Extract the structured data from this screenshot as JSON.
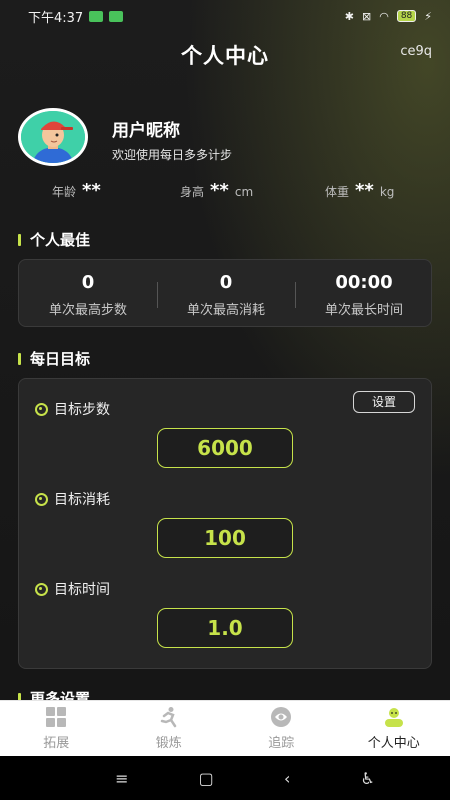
{
  "status_bar": {
    "time": "下午4:37",
    "battery": "88"
  },
  "header": {
    "title": "个人中心",
    "code": "ce9q"
  },
  "profile": {
    "nickname": "用户昵称",
    "welcome": "欢迎使用每日多多计步",
    "stats": [
      {
        "label": "年龄",
        "value": "**",
        "unit": ""
      },
      {
        "label": "身高",
        "value": "**",
        "unit": "cm"
      },
      {
        "label": "体重",
        "value": "**",
        "unit": "kg"
      }
    ]
  },
  "best": {
    "title": "个人最佳",
    "items": [
      {
        "value": "0",
        "label": "单次最高步数"
      },
      {
        "value": "0",
        "label": "单次最高消耗"
      },
      {
        "value": "00:00",
        "label": "单次最长时间"
      }
    ]
  },
  "daily": {
    "title": "每日目标",
    "set_button": "设置",
    "goals": [
      {
        "label": "目标步数",
        "value": "6000"
      },
      {
        "label": "目标消耗",
        "value": "100"
      },
      {
        "label": "目标时间",
        "value": "1.0"
      }
    ]
  },
  "more": {
    "title": "更多设置"
  },
  "tabs": [
    {
      "label": "拓展",
      "icon": "grid-icon",
      "active": false
    },
    {
      "label": "锻炼",
      "icon": "runner-icon",
      "active": false
    },
    {
      "label": "追踪",
      "icon": "track-icon",
      "active": false
    },
    {
      "label": "个人中心",
      "icon": "person-icon",
      "active": true
    }
  ],
  "colors": {
    "accent": "#c6e24a",
    "background": "#161616",
    "card": "#262626"
  }
}
